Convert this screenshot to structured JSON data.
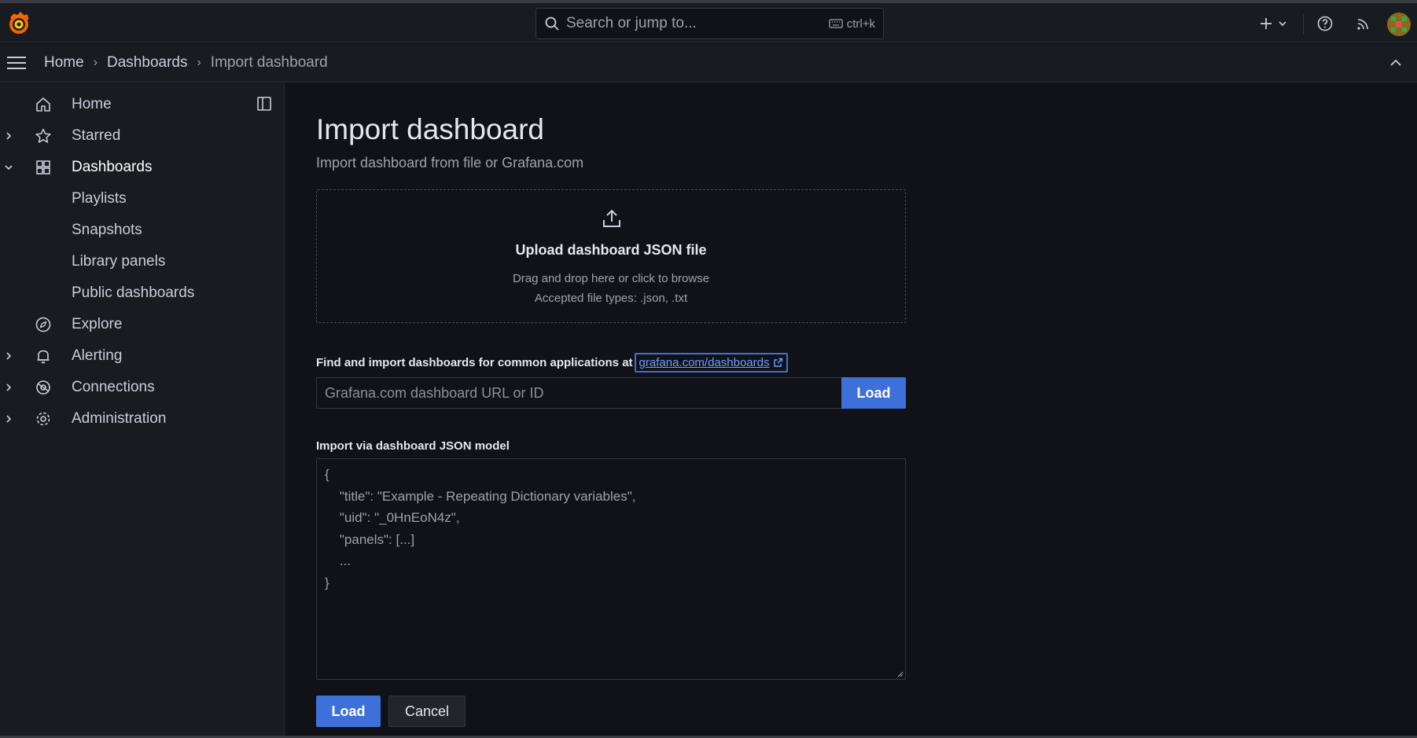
{
  "search": {
    "placeholder": "Search or jump to...",
    "shortcut": "ctrl+k"
  },
  "breadcrumb": [
    "Home",
    "Dashboards",
    "Import dashboard"
  ],
  "sidebar": {
    "items": [
      {
        "label": "Home",
        "icon": "home-icon"
      },
      {
        "label": "Starred",
        "icon": "star-icon"
      },
      {
        "label": "Dashboards",
        "icon": "dashboards-grid-icon"
      },
      {
        "label": "Playlists"
      },
      {
        "label": "Snapshots"
      },
      {
        "label": "Library panels"
      },
      {
        "label": "Public dashboards"
      },
      {
        "label": "Explore",
        "icon": "compass-icon"
      },
      {
        "label": "Alerting",
        "icon": "bell-icon"
      },
      {
        "label": "Connections",
        "icon": "connections-icon"
      },
      {
        "label": "Administration",
        "icon": "gear-icon"
      }
    ]
  },
  "main": {
    "title": "Import dashboard",
    "subtitle": "Import dashboard from file or Grafana.com",
    "upload": {
      "heading": "Upload dashboard JSON file",
      "hint": "Drag and drop here or click to browse",
      "types": "Accepted file types: .json, .txt"
    },
    "find_label": "Find and import dashboards for common applications at",
    "find_link": "grafana.com/dashboards",
    "url_placeholder": "Grafana.com dashboard URL or ID",
    "url_load": "Load",
    "json_label": "Import via dashboard JSON model",
    "json_placeholder": [
      "{",
      "    \"title\": \"Example - Repeating Dictionary variables\",",
      "    \"uid\": \"_0HnEoN4z\",",
      "    \"panels\": [...]",
      "    ...",
      "}"
    ],
    "load_button": "Load",
    "cancel_button": "Cancel"
  },
  "colors": {
    "accent": "#3d71d9",
    "background": "#111217",
    "panel": "#181b1f",
    "link": "#6e9fff"
  }
}
